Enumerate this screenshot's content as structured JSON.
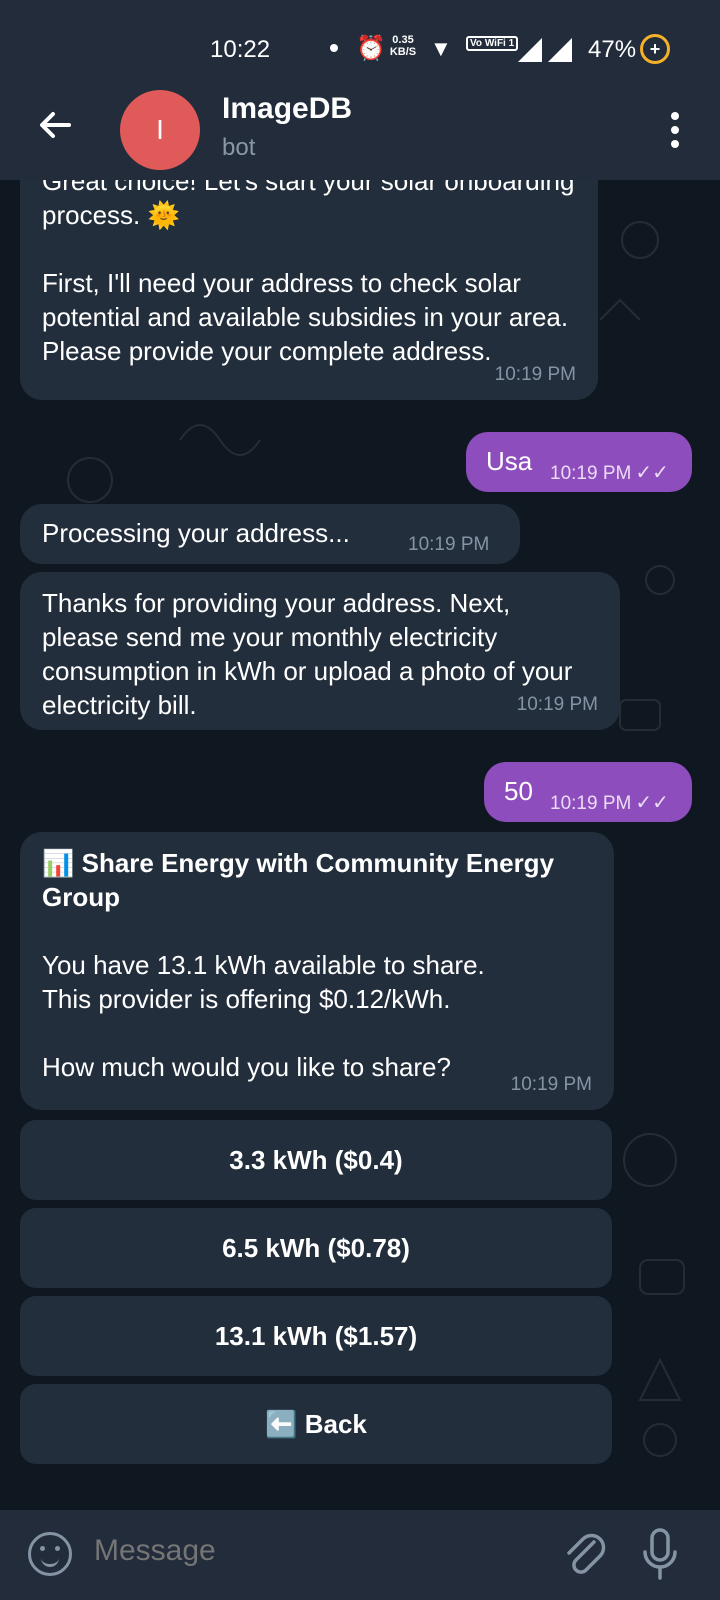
{
  "status_bar": {
    "time": "10:22",
    "speed_value": "0.35",
    "speed_unit": "KB/S",
    "vowifi": "Vo WiFi 1",
    "battery": "47%"
  },
  "header": {
    "avatar_letter": "I",
    "title": "ImageDB",
    "subtitle": "bot"
  },
  "messages": [
    {
      "dir": "in",
      "text": "Great choice! Let's start your solar onboarding process. 🌞\n\nFirst, I'll need your address to check solar potential and available subsidies in your area. Please provide your complete address.",
      "time": "10:19 PM"
    },
    {
      "dir": "out",
      "text": "Usa",
      "time": "10:19 PM"
    },
    {
      "dir": "in",
      "text": "Processing your address...",
      "time": "10:19 PM"
    },
    {
      "dir": "in",
      "text": "Thanks for providing your address. Next, please send me your monthly electricity consumption in kWh or upload a photo of your electricity bill.",
      "time": "10:19 PM"
    },
    {
      "dir": "out",
      "text": "50",
      "time": "10:19 PM"
    },
    {
      "dir": "in",
      "heading": "📊 Share Energy with Community Energy Group",
      "text": "You have 13.1 kWh available to share.\nThis provider is offering $0.12/kWh.\n\nHow much would you like to share?",
      "time": "10:19 PM"
    }
  ],
  "keyboard": [
    {
      "label": "3.3 kWh ($0.4)"
    },
    {
      "label": "6.5 kWh ($0.78)"
    },
    {
      "label": "13.1 kWh ($1.57)"
    },
    {
      "label": "⬅️ Back"
    }
  ],
  "input": {
    "placeholder": "Message"
  },
  "colors": {
    "incoming_bubble": "#232e3c",
    "outgoing_bubble": "#8e4dbd",
    "avatar": "#e05a5a",
    "background": "#0f1720"
  }
}
